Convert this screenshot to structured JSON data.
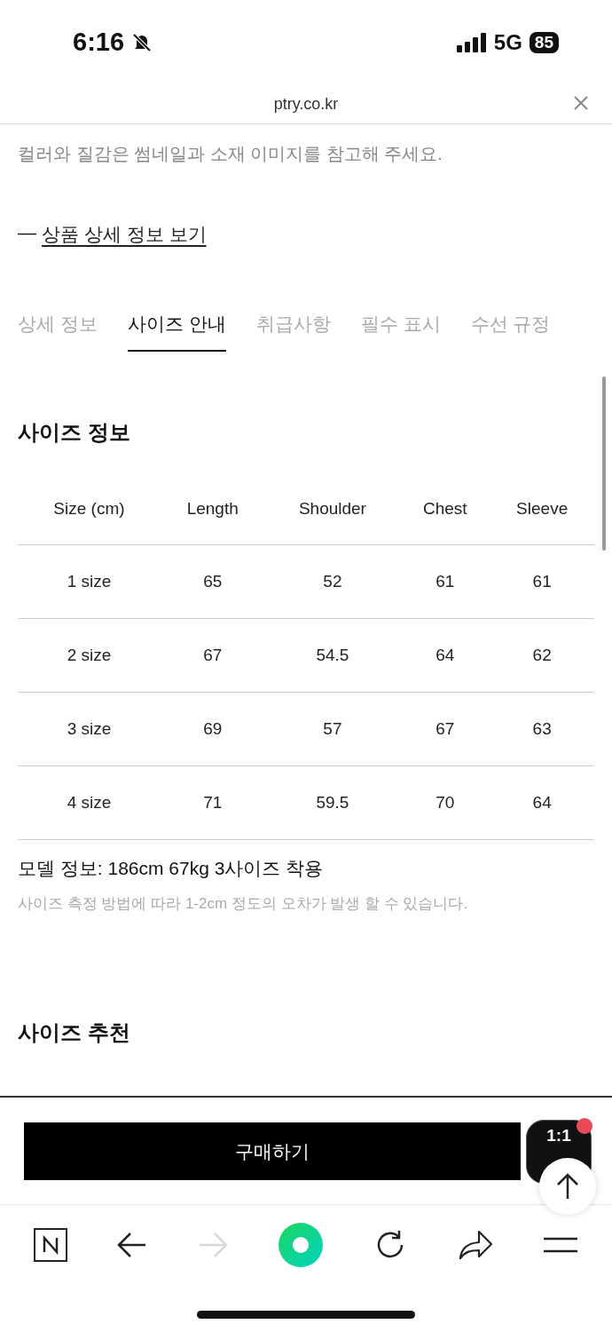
{
  "status_bar": {
    "time": "6:16",
    "network": "5G",
    "battery": "85"
  },
  "browser": {
    "url": "ptry.co.kr"
  },
  "intro_text": "컬러와 질감은 썸네일과 소재 이미지를 참고해 주세요.",
  "detail_link": {
    "dash": "—",
    "label": "상품 상세 정보 보기"
  },
  "tabs": [
    {
      "label": "상세 정보",
      "selected": false
    },
    {
      "label": "사이즈 안내",
      "selected": true
    },
    {
      "label": "취급사항",
      "selected": false
    },
    {
      "label": "필수 표시",
      "selected": false
    },
    {
      "label": "수선 규정",
      "selected": false
    }
  ],
  "size_info": {
    "title": "사이즈 정보",
    "table": {
      "columns": [
        "Size (cm)",
        "Length",
        "Shoulder",
        "Chest",
        "Sleeve"
      ],
      "rows": [
        [
          "1 size",
          "65",
          "52",
          "61",
          "61"
        ],
        [
          "2 size",
          "67",
          "54.5",
          "64",
          "62"
        ],
        [
          "3 size",
          "69",
          "57",
          "67",
          "63"
        ],
        [
          "4 size",
          "71",
          "59.5",
          "70",
          "64"
        ]
      ]
    },
    "model_info": "모델 정보: 186cm 67kg 3사이즈 착용",
    "note": "사이즈 측정 방법에 따라 1-2cm 정도의 오차가 발생 할 수 있습니다."
  },
  "recommend_title": "사이즈 추천",
  "buy_button": "구매하기",
  "talk_button": {
    "label": "1:1",
    "unread": true
  },
  "toolbar": [
    {
      "kind": "naver",
      "disabled": false
    },
    {
      "kind": "back",
      "disabled": false
    },
    {
      "kind": "forward",
      "disabled": true
    },
    {
      "kind": "home",
      "disabled": false
    },
    {
      "kind": "reload",
      "disabled": false
    },
    {
      "kind": "share",
      "disabled": false
    },
    {
      "kind": "menu",
      "disabled": false
    }
  ]
}
